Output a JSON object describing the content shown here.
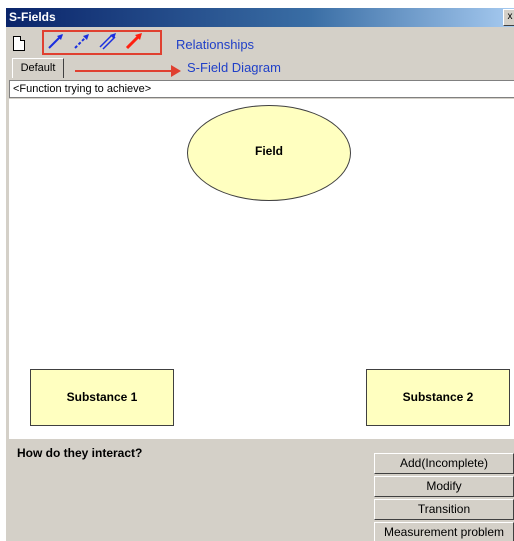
{
  "window": {
    "title": "S-Fields",
    "close_glyph": "x"
  },
  "toolbar": {
    "new_icon": "new-document-icon",
    "relationship_icons": [
      {
        "name": "normal-relationship-arrow-icon",
        "color": "#1a2ee0"
      },
      {
        "name": "insufficient-relationship-arrow-icon",
        "color": "#1a2ee0"
      },
      {
        "name": "excessive-relationship-arrow-icon",
        "color": "#1a2ee0"
      },
      {
        "name": "harmful-relationship-arrow-icon",
        "color": "#ff2010"
      }
    ],
    "relationships_annotation": "Relationships"
  },
  "tabs": {
    "default_label": "Default",
    "diagram_annotation": "S-Field Diagram"
  },
  "function_field": {
    "value": "<Function trying to achieve>"
  },
  "diagram": {
    "field_label": "Field",
    "substance1_label": "Substance 1",
    "substance2_label": "Substance 2",
    "node_fill": "#ffffc0"
  },
  "bottom": {
    "question": "How do they interact?",
    "buttons": {
      "add": "Add(Incomplete)",
      "modify": "Modify",
      "transition": "Transition",
      "measurement": "Measurement problem"
    }
  },
  "colors": {
    "annotation": "#2040c8",
    "highlight": "#e04030",
    "titlebar": "#0a246a"
  }
}
